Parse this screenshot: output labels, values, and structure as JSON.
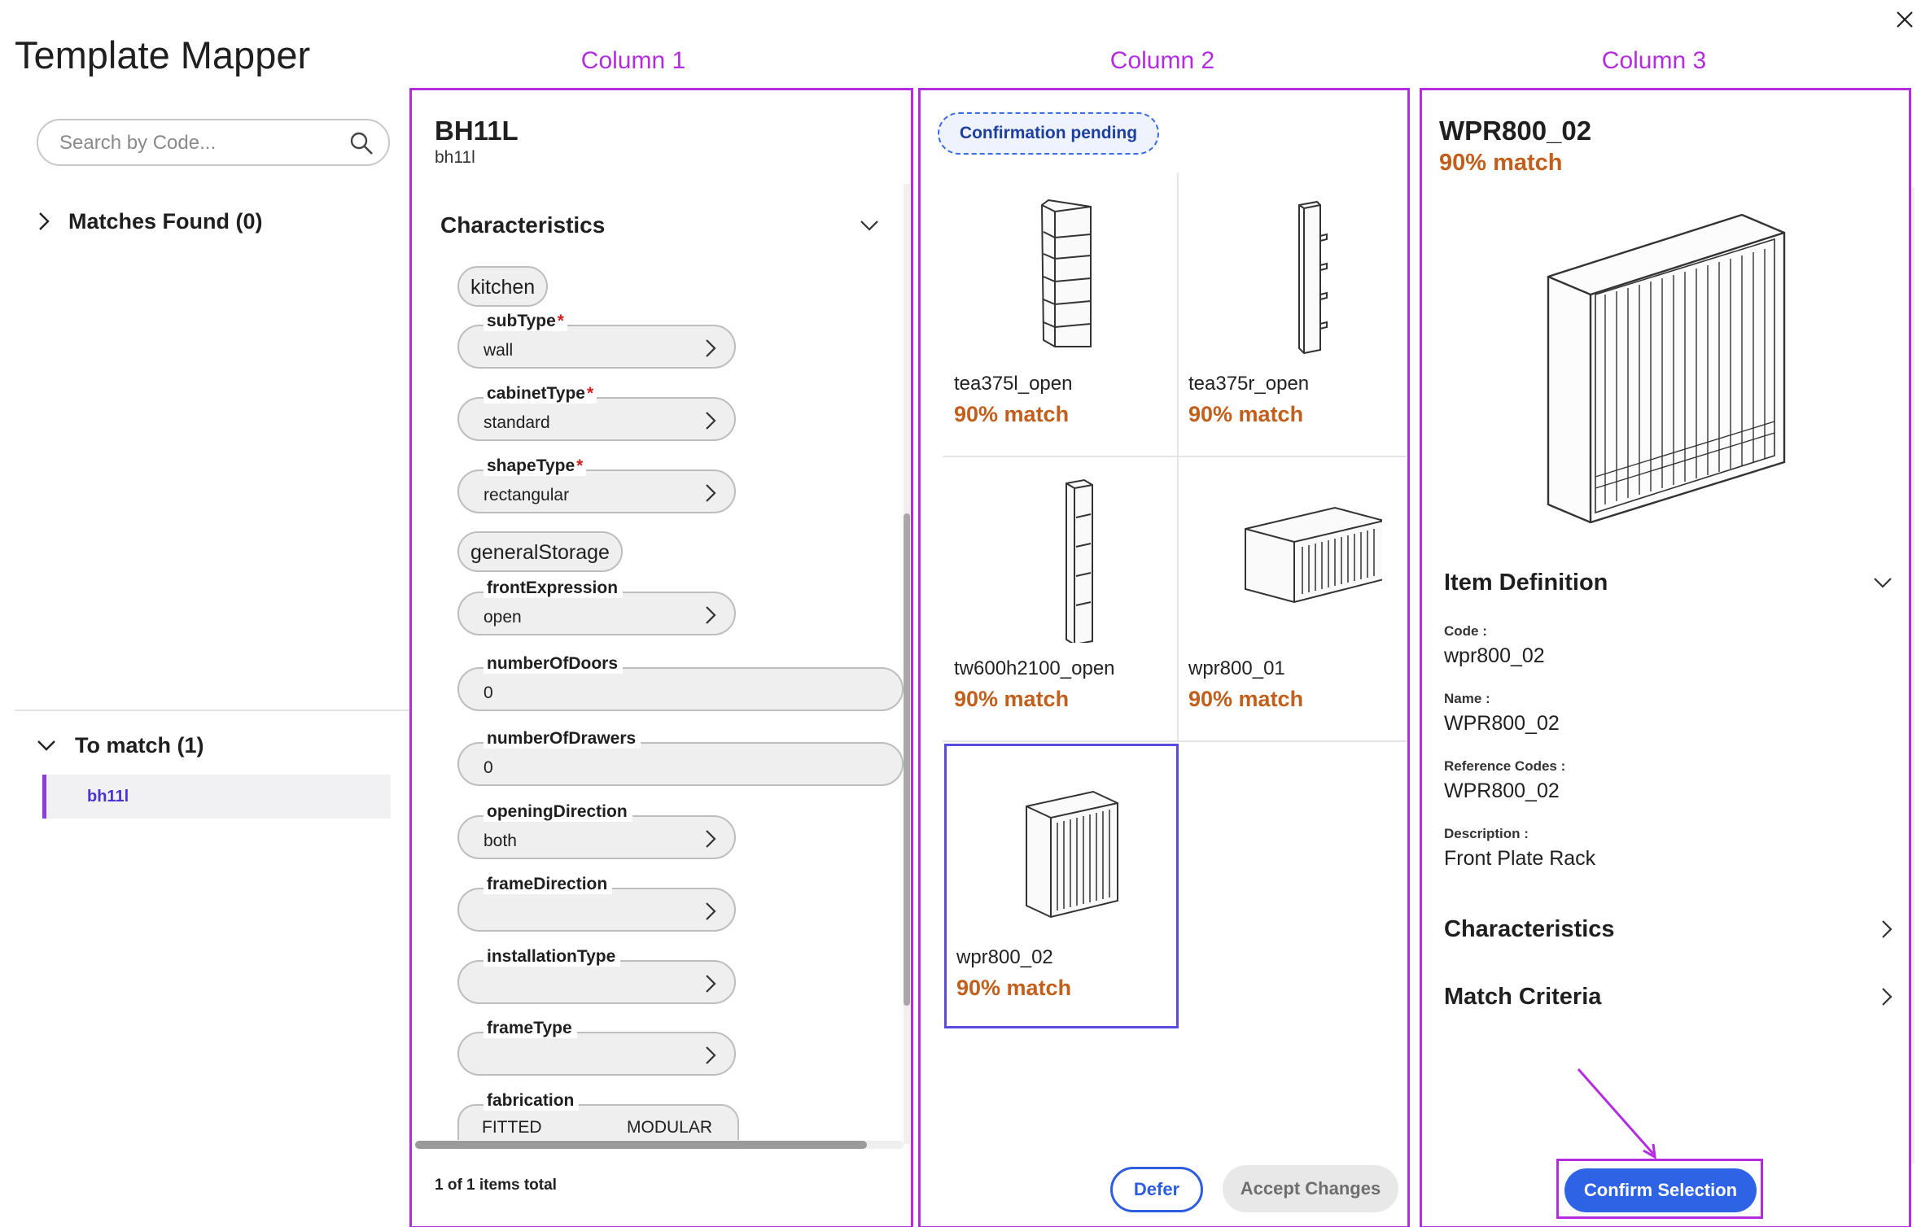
{
  "header": {
    "title": "Template Mapper"
  },
  "search": {
    "placeholder": "Search by Code..."
  },
  "left": {
    "matches_label": "Matches Found (0)",
    "to_match_label": "To match (1)",
    "to_match_items": [
      "bh11l"
    ]
  },
  "column_labels": [
    "Column 1",
    "Column 2",
    "Column 3"
  ],
  "column1": {
    "title": "BH11L",
    "subtitle": "bh11l",
    "characteristics_label": "Characteristics",
    "groups": [
      "kitchen",
      "generalStorage"
    ],
    "fields": [
      {
        "label": "subType",
        "required": "*",
        "value": "wall"
      },
      {
        "label": "cabinetType",
        "required": "*",
        "value": "standard"
      },
      {
        "label": "shapeType",
        "required": "*",
        "value": "rectangular"
      },
      {
        "label": "frontExpression",
        "required": "",
        "value": "open"
      },
      {
        "label": "numberOfDoors",
        "required": "",
        "value": "0"
      },
      {
        "label": "numberOfDrawers",
        "required": "",
        "value": "0"
      },
      {
        "label": "openingDirection",
        "required": "",
        "value": "both"
      },
      {
        "label": "frameDirection",
        "required": "",
        "value": ""
      },
      {
        "label": "installationType",
        "required": "",
        "value": ""
      },
      {
        "label": "frameType",
        "required": "",
        "value": ""
      },
      {
        "label": "fabrication",
        "required": "",
        "value": "FITTED",
        "value2": "MODULAR"
      }
    ],
    "items_total": "1 of 1 items total"
  },
  "column2": {
    "badge": "Confirmation pending",
    "cards": [
      {
        "name": "tea375l_open",
        "match": "90% match"
      },
      {
        "name": "tea375r_open",
        "match": "90% match"
      },
      {
        "name": "tw600h2100_open",
        "match": "90% match"
      },
      {
        "name": "wpr800_01",
        "match": "90% match"
      },
      {
        "name": "wpr800_02",
        "match": "90% match"
      }
    ],
    "defer_label": "Defer",
    "accept_label": "Accept Changes"
  },
  "column3": {
    "title": "WPR800_02",
    "match": "90% match",
    "item_definition_label": "Item Definition",
    "definition": [
      {
        "key": "Code :",
        "value": "wpr800_02"
      },
      {
        "key": "Name :",
        "value": "WPR800_02"
      },
      {
        "key": "Reference Codes :",
        "value": "WPR800_02"
      },
      {
        "key": "Description :",
        "value": "Front Plate Rack"
      }
    ],
    "characteristics_label": "Characteristics",
    "match_criteria_label": "Match Criteria",
    "confirm_label": "Confirm Selection"
  },
  "colors": {
    "highlight": "#b22de0",
    "match": "#c25f1c",
    "primary": "#2e63e6",
    "selected_border": "#5a4be0"
  },
  "icons": [
    "close-icon",
    "search-icon",
    "chevron-right-icon",
    "chevron-down-icon",
    "arrow-annotation"
  ]
}
